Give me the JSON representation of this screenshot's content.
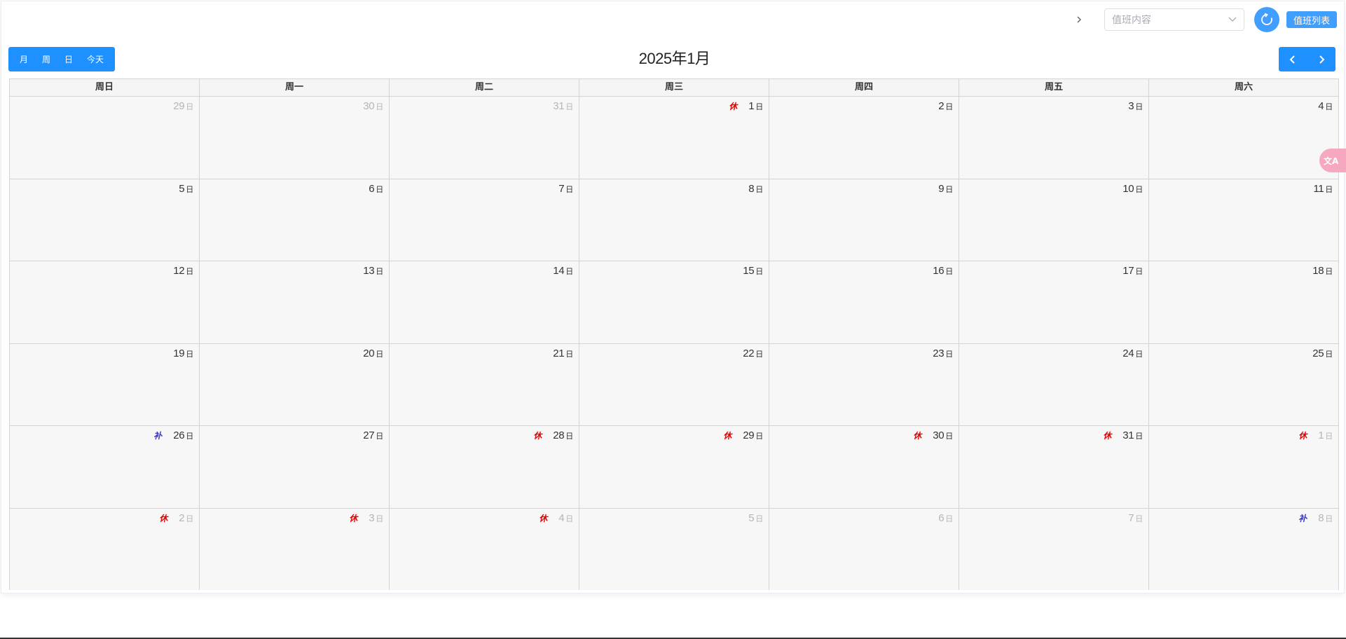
{
  "toolbar": {
    "select_placeholder": "值班内容",
    "list_button": "值班列表"
  },
  "calendar": {
    "title": "2025年1月",
    "views": [
      "月",
      "周",
      "日",
      "今天"
    ],
    "weekdays": [
      "周日",
      "周一",
      "周二",
      "周三",
      "周四",
      "周五",
      "周六"
    ],
    "day_suffix": "日",
    "weeks": [
      [
        {
          "d": "29",
          "other": true,
          "tag": ""
        },
        {
          "d": "30",
          "other": true,
          "tag": ""
        },
        {
          "d": "31",
          "other": true,
          "tag": ""
        },
        {
          "d": "1",
          "other": false,
          "tag": "休"
        },
        {
          "d": "2",
          "other": false,
          "tag": ""
        },
        {
          "d": "3",
          "other": false,
          "tag": ""
        },
        {
          "d": "4",
          "other": false,
          "tag": ""
        }
      ],
      [
        {
          "d": "5",
          "other": false,
          "tag": ""
        },
        {
          "d": "6",
          "other": false,
          "tag": ""
        },
        {
          "d": "7",
          "other": false,
          "tag": ""
        },
        {
          "d": "8",
          "other": false,
          "tag": ""
        },
        {
          "d": "9",
          "other": false,
          "tag": ""
        },
        {
          "d": "10",
          "other": false,
          "tag": ""
        },
        {
          "d": "11",
          "other": false,
          "tag": ""
        }
      ],
      [
        {
          "d": "12",
          "other": false,
          "tag": ""
        },
        {
          "d": "13",
          "other": false,
          "tag": ""
        },
        {
          "d": "14",
          "other": false,
          "tag": ""
        },
        {
          "d": "15",
          "other": false,
          "tag": ""
        },
        {
          "d": "16",
          "other": false,
          "tag": ""
        },
        {
          "d": "17",
          "other": false,
          "tag": ""
        },
        {
          "d": "18",
          "other": false,
          "tag": ""
        }
      ],
      [
        {
          "d": "19",
          "other": false,
          "tag": ""
        },
        {
          "d": "20",
          "other": false,
          "tag": ""
        },
        {
          "d": "21",
          "other": false,
          "tag": ""
        },
        {
          "d": "22",
          "other": false,
          "tag": ""
        },
        {
          "d": "23",
          "other": false,
          "tag": ""
        },
        {
          "d": "24",
          "other": false,
          "tag": ""
        },
        {
          "d": "25",
          "other": false,
          "tag": ""
        }
      ],
      [
        {
          "d": "26",
          "other": false,
          "tag": "补"
        },
        {
          "d": "27",
          "other": false,
          "tag": ""
        },
        {
          "d": "28",
          "other": false,
          "tag": "休"
        },
        {
          "d": "29",
          "other": false,
          "tag": "休"
        },
        {
          "d": "30",
          "other": false,
          "tag": "休"
        },
        {
          "d": "31",
          "other": false,
          "tag": "休"
        },
        {
          "d": "1",
          "other": true,
          "tag": "休"
        }
      ],
      [
        {
          "d": "2",
          "other": true,
          "tag": "休"
        },
        {
          "d": "3",
          "other": true,
          "tag": "休"
        },
        {
          "d": "4",
          "other": true,
          "tag": "休"
        },
        {
          "d": "5",
          "other": true,
          "tag": ""
        },
        {
          "d": "6",
          "other": true,
          "tag": ""
        },
        {
          "d": "7",
          "other": true,
          "tag": ""
        },
        {
          "d": "8",
          "other": true,
          "tag": "补"
        }
      ]
    ]
  },
  "colors": {
    "accent": "#1e90ff",
    "rest_tag": "#e60000",
    "work_tag": "#3a3ab8"
  },
  "icons": {
    "expand": "chevron-right-icon",
    "select": "chevron-down-icon",
    "refresh": "refresh-icon",
    "prev": "chevron-left-icon",
    "next": "chevron-right-icon",
    "translate": "translate-icon"
  },
  "float_widget": {
    "label": "文A"
  }
}
